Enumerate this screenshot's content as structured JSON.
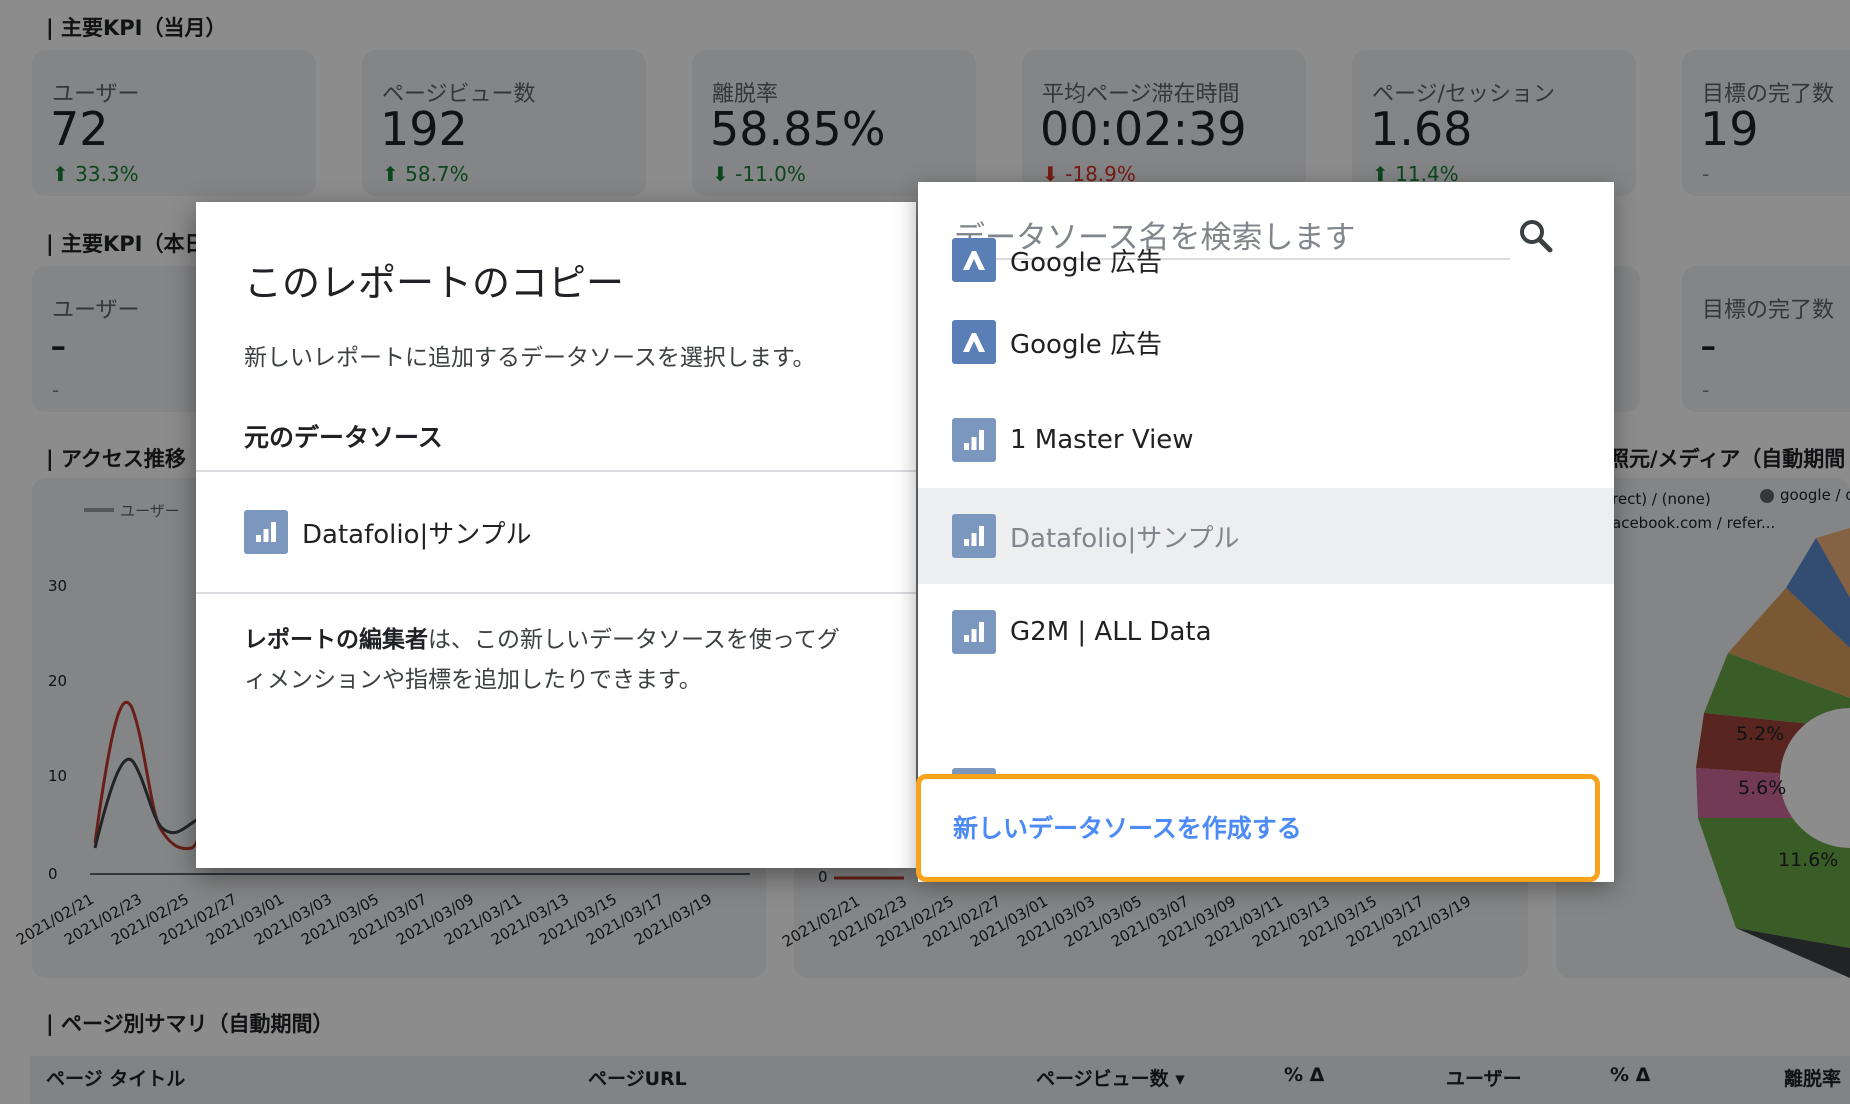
{
  "sections": {
    "kpi_month": "| 主要KPI（当月）",
    "kpi_today": "| 主要KPI（本日",
    "access_trend": "| アクセス推移",
    "source_medium": "照元/メディア（自動期間",
    "page_summary": "| ページ別サマリ（自動期間）"
  },
  "kpi_month": [
    {
      "label": "ユーザー",
      "value": "72",
      "delta": "33.3%",
      "trend": "up"
    },
    {
      "label": "ページビュー数",
      "value": "192",
      "delta": "58.7%",
      "trend": "up"
    },
    {
      "label": "離脱率",
      "value": "58.85%",
      "delta": "-11.0%",
      "trend": "up"
    },
    {
      "label": "平均ページ滞在時間",
      "value": "00:02:39",
      "delta": "-18.9%",
      "trend": "down"
    },
    {
      "label": "ページ/セッション",
      "value": "1.68",
      "delta": "11.4%",
      "trend": "up"
    },
    {
      "label": "目標の完了数",
      "value": "19",
      "delta": "-",
      "trend": "none"
    }
  ],
  "kpi_today": [
    {
      "label": "ユーザー",
      "value": "-",
      "delta": "-"
    },
    {
      "label": "目標の完了数",
      "value": "-",
      "delta": "-"
    }
  ],
  "line_chart": {
    "legend": "ユーザー",
    "y_ticks": [
      "30",
      "20",
      "10",
      "0"
    ],
    "x_ticks": [
      "2021/02/21",
      "2021/02/23",
      "2021/02/25",
      "2021/02/27",
      "2021/03/01",
      "2021/03/03",
      "2021/03/05",
      "2021/03/07",
      "2021/03/09",
      "2021/03/11",
      "2021/03/13",
      "2021/03/15",
      "2021/03/17",
      "2021/03/19"
    ],
    "colors": {
      "series_a": "#c0392b",
      "series_b": "#3c4043"
    }
  },
  "second_chart": {
    "y_ticks": [
      "0"
    ],
    "x_ticks": [
      "2021/02/21",
      "2021/02/23",
      "2021/02/25",
      "2021/02/27",
      "2021/03/01",
      "2021/03/03",
      "2021/03/05",
      "2021/03/07",
      "2021/03/09",
      "2021/03/11",
      "2021/03/13",
      "2021/03/15",
      "2021/03/17",
      "2021/03/19"
    ]
  },
  "donut": {
    "legend": [
      "rect) / (none)",
      "google / o",
      "acebook.com / refer..."
    ],
    "slice_labels": [
      "5.2%",
      "5.6%",
      "11.6%"
    ]
  },
  "table": {
    "headers": [
      "ページ タイトル",
      "ページURL",
      "ページビュー数 ▾",
      "% Δ",
      "ユーザー",
      "% Δ",
      "離脱率"
    ]
  },
  "dialog": {
    "title": "このレポートのコピー",
    "description": "新しいレポートに追加するデータソースを選択します。",
    "source_label": "元のデータソース",
    "source_name": "Datafolio|サンプル",
    "note_bold": "レポートの編集者",
    "note_line1": "は、この新しいデータソースを使ってグ",
    "note_line2": "ィメンションや指標を追加したりできます。"
  },
  "dropdown": {
    "search_placeholder": "データソース名を検索します",
    "items": [
      {
        "name": "Google 広告",
        "icon": "google-ads-icon",
        "selected": false
      },
      {
        "name": "Google 広告",
        "icon": "google-ads-icon",
        "selected": false
      },
      {
        "name": "1 Master View",
        "icon": "analytics-icon",
        "selected": false
      },
      {
        "name": "Datafolio|サンプル",
        "icon": "analytics-icon",
        "selected": true
      },
      {
        "name": "G2M | ALL Data",
        "icon": "analytics-icon",
        "selected": false
      }
    ],
    "create_label": "新しいデータソースを作成する"
  },
  "colors": {
    "accent_orange": "#f9a21b",
    "link_blue": "#4c8bf5",
    "icon_blue": "#7b97be"
  }
}
